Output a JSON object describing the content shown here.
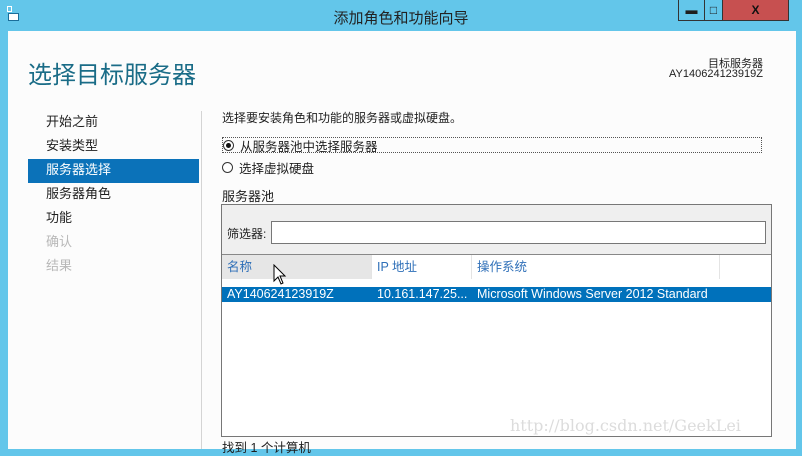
{
  "window": {
    "title": "添加角色和功能向导",
    "minimize": "▬",
    "maximize": "□",
    "close": "X"
  },
  "header": {
    "page_title": "选择目标服务器",
    "dest_label": "目标服务器",
    "dest_value": "AY140624123919Z"
  },
  "nav": [
    {
      "label": "开始之前"
    },
    {
      "label": "安装类型"
    },
    {
      "label": "服务器选择"
    },
    {
      "label": "服务器角色"
    },
    {
      "label": "功能"
    },
    {
      "label": "确认"
    },
    {
      "label": "结果"
    }
  ],
  "main": {
    "intro": "选择要安装角色和功能的服务器或虚拟硬盘。",
    "radio_pool": "从服务器池中选择服务器",
    "radio_vhd": "选择虚拟硬盘",
    "pool_label": "服务器池",
    "filter_label": "筛选器:",
    "filter_value": "",
    "columns": [
      "名称",
      "IP 地址",
      "操作系统"
    ],
    "rows": [
      {
        "name": "AY140624123919Z",
        "ip": "10.161.147.25...",
        "os": "Microsoft Windows Server 2012 Standard"
      }
    ],
    "found": "找到 1 个计算机"
  },
  "watermark": "http://blog.csdn.net/GeekLei"
}
